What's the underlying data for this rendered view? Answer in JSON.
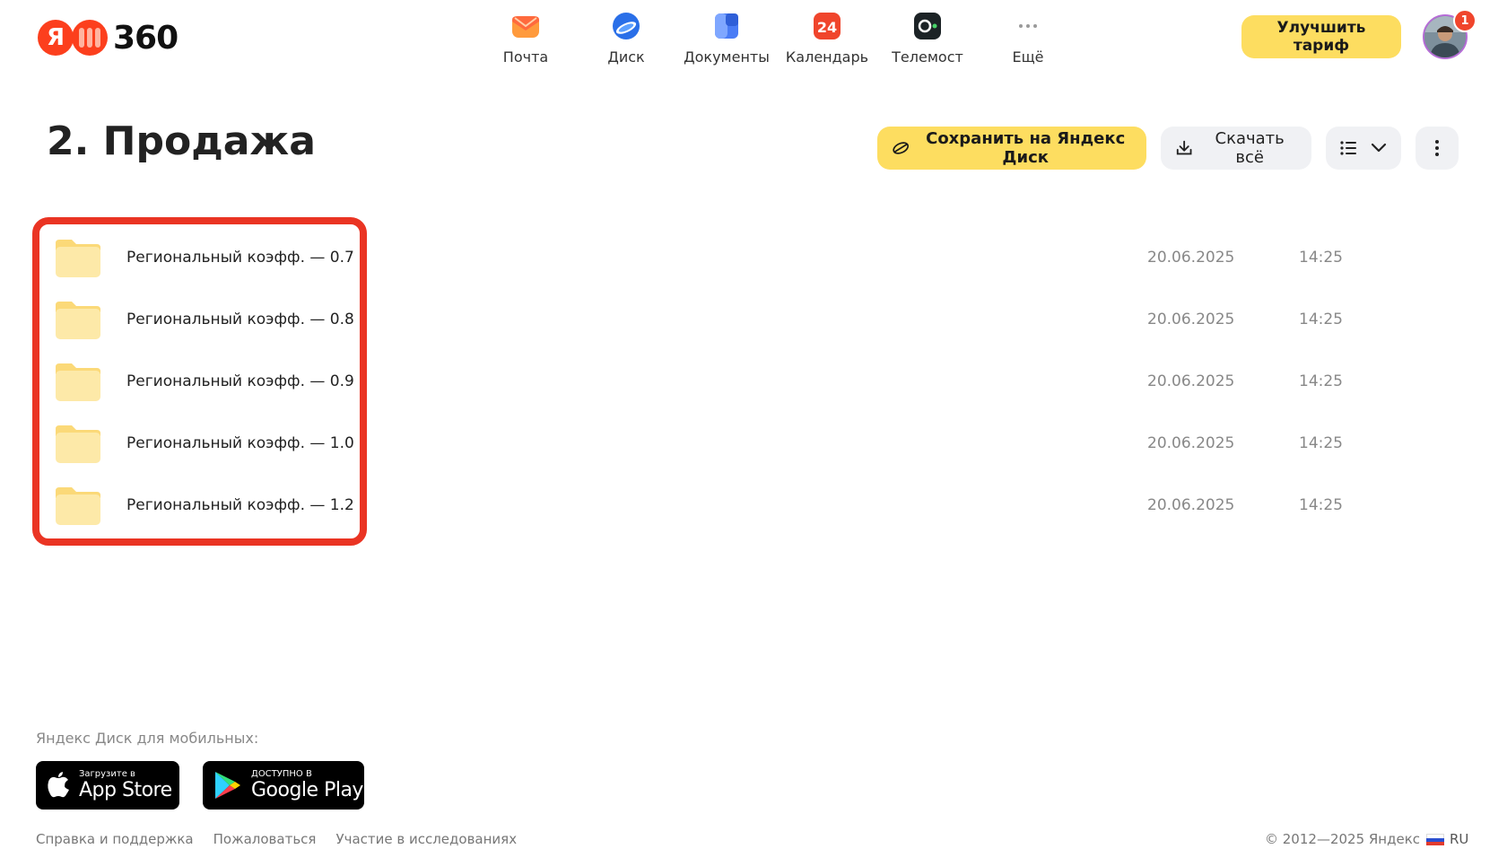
{
  "header": {
    "logo_text": "360",
    "logo_ya": "Я",
    "services": [
      {
        "label": "Почта",
        "icon": "mail-icon"
      },
      {
        "label": "Диск",
        "icon": "disk-icon"
      },
      {
        "label": "Документы",
        "icon": "documents-icon"
      },
      {
        "label": "Календарь",
        "icon": "calendar-icon",
        "day": "24"
      },
      {
        "label": "Телемост",
        "icon": "telemost-icon"
      },
      {
        "label": "Ещё",
        "icon": "more-dots-icon"
      }
    ],
    "upgrade_label": "Улучшить тариф",
    "notification_count": "1"
  },
  "folder": {
    "title": "2. Продажа",
    "save_label": "Сохранить на Яндекс Диск",
    "download_label": "Скачать всё"
  },
  "files": [
    {
      "name": "Региональный коэфф. — 0.7",
      "date": "20.06.2025",
      "time": "14:25"
    },
    {
      "name": "Региональный коэфф. — 0.8",
      "date": "20.06.2025",
      "time": "14:25"
    },
    {
      "name": "Региональный коэфф. — 0.9",
      "date": "20.06.2025",
      "time": "14:25"
    },
    {
      "name": "Региональный коэфф. — 1.0",
      "date": "20.06.2025",
      "time": "14:25"
    },
    {
      "name": "Региональный коэфф. — 1.2",
      "date": "20.06.2025",
      "time": "14:25"
    }
  ],
  "footer": {
    "mobile_label": "Яндекс Диск для мобильных:",
    "appstore_small": "Загрузите в",
    "appstore_big": "App Store",
    "googleplay_small": "ДОСТУПНО В",
    "googleplay_big": "Google Play",
    "links": [
      "Справка и поддержка",
      "Пожаловаться",
      "Участие в исследованиях"
    ],
    "copyright": "© 2012—2025 Яндекс",
    "lang": "RU"
  },
  "colors": {
    "accent_yellow": "#fddd60",
    "highlight_red": "#ea3423",
    "folder_yellow": "#fde9a8"
  }
}
